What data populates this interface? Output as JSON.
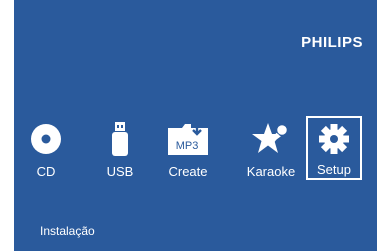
{
  "brand": "PHILIPS",
  "colors": {
    "background": "#2a5a9c",
    "foreground": "#ffffff",
    "selection": "#ffffff"
  },
  "menu": {
    "selected": "Setup",
    "items": [
      {
        "label": "CD",
        "icon": "disc-icon"
      },
      {
        "label": "USB",
        "icon": "usb-drive-icon"
      },
      {
        "label": "Create",
        "icon": "mp3-folder-icon",
        "icon_text": "MP3"
      },
      {
        "label": "Karaoke",
        "icon": "star-microphone-icon"
      },
      {
        "label": "Setup",
        "icon": "gear-icon"
      }
    ]
  },
  "status_text": "Instalação"
}
